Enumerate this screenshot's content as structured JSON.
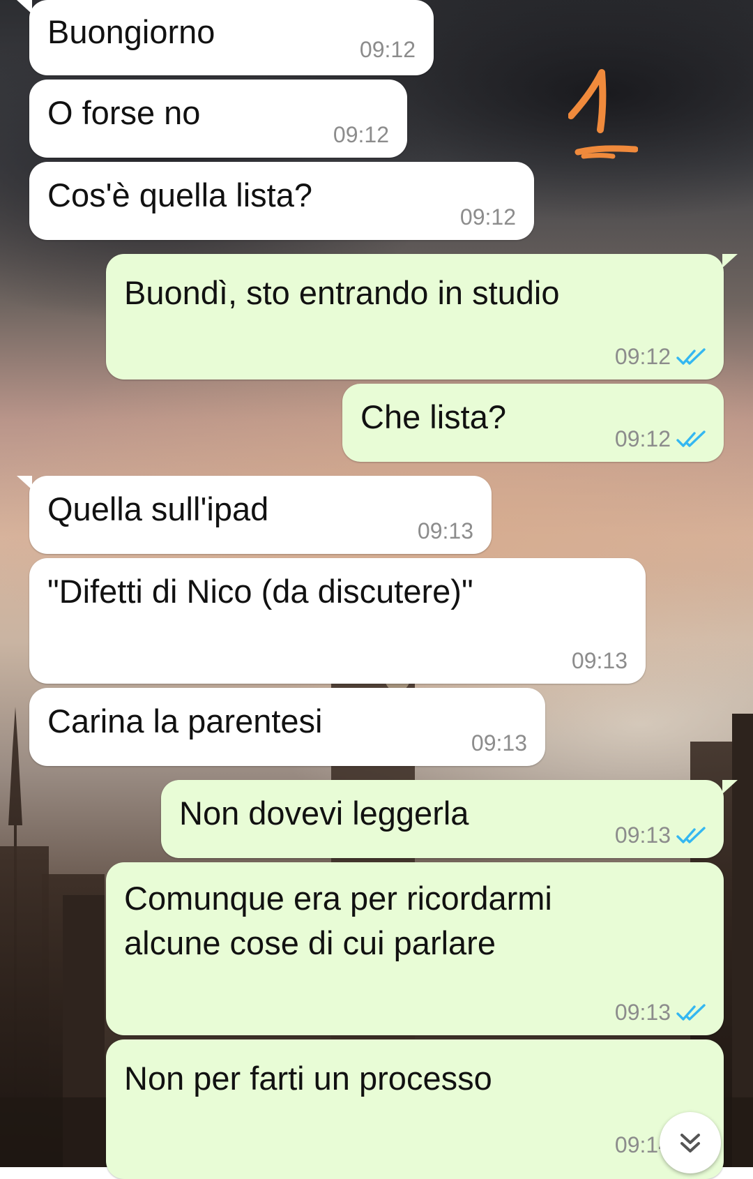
{
  "messages": [
    {
      "text": "Buongiorno",
      "time": "09:12",
      "direction": "incoming"
    },
    {
      "text": "O forse no",
      "time": "09:12",
      "direction": "incoming"
    },
    {
      "text": "Cos'è quella lista?",
      "time": "09:12",
      "direction": "incoming"
    },
    {
      "text": "Buondì, sto entrando in studio",
      "time": "09:12",
      "direction": "outgoing",
      "status": "read"
    },
    {
      "text": "Che lista?",
      "time": "09:12",
      "direction": "outgoing",
      "status": "read"
    },
    {
      "text": "Quella sull'ipad",
      "time": "09:13",
      "direction": "incoming"
    },
    {
      "text": "\"Difetti di Nico (da discutere)\"",
      "time": "09:13",
      "direction": "incoming"
    },
    {
      "text": "Carina la parentesi",
      "time": "09:13",
      "direction": "incoming"
    },
    {
      "text": "Non dovevi leggerla",
      "time": "09:13",
      "direction": "outgoing",
      "status": "read"
    },
    {
      "lines": [
        "Comunque era per ricordarmi",
        "alcune cose di cui parlare"
      ],
      "time": "09:13",
      "direction": "outgoing",
      "status": "read"
    },
    {
      "text": "Non per farti un processo",
      "time": "09:14",
      "direction": "outgoing",
      "status": "read"
    }
  ],
  "annotation_text": "1",
  "scroll_button_icon": "double-chevron-down-icon",
  "colors": {
    "incoming_bubble": "#ffffff",
    "outgoing_bubble": "#e8fcd6",
    "read_ticks": "#34b7f1",
    "annotation": "#f08a3c",
    "timestamp": "#8c8c8c"
  }
}
